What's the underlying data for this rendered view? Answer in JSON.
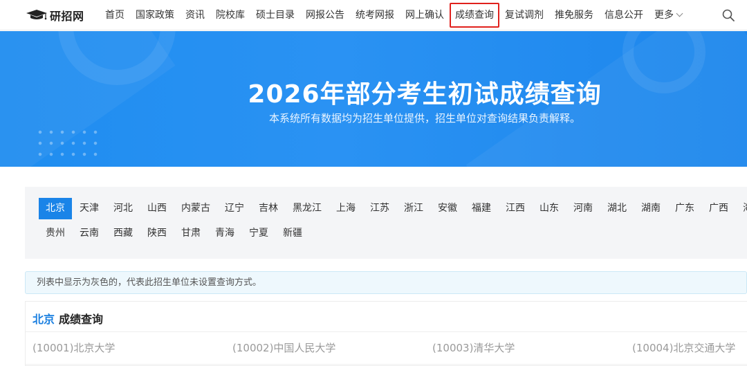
{
  "nav": {
    "logo_text": "研招网",
    "items": [
      {
        "label": "首页"
      },
      {
        "label": "国家政策"
      },
      {
        "label": "资讯"
      },
      {
        "label": "院校库"
      },
      {
        "label": "硕士目录"
      },
      {
        "label": "网报公告"
      },
      {
        "label": "统考网报"
      },
      {
        "label": "网上确认"
      },
      {
        "label": "成绩查询",
        "active": true
      },
      {
        "label": "复试调剂"
      },
      {
        "label": "推免服务"
      },
      {
        "label": "信息公开"
      }
    ],
    "more_label": "更多",
    "search_icon": "search-icon",
    "active_highlight_color": "#e0201c"
  },
  "banner": {
    "title": "2026年部分考生初试成绩查询",
    "subtitle": "本系统所有数据均为招生单位提供，招生单位对查询结果负责解释。",
    "background_color": "#2a92f3"
  },
  "provinces": {
    "row1": [
      "北京",
      "天津",
      "河北",
      "山西",
      "内蒙古",
      "辽宁",
      "吉林",
      "黑龙江",
      "上海",
      "江苏",
      "浙江",
      "安徽",
      "福建",
      "江西",
      "山东",
      "河南",
      "湖北",
      "湖南",
      "广东",
      "广西",
      "海南"
    ],
    "row2": [
      "贵州",
      "云南",
      "西藏",
      "陕西",
      "甘肃",
      "青海",
      "宁夏",
      "新疆"
    ],
    "selected": "北京",
    "selected_color": "#1a84e8"
  },
  "notice": {
    "text": "列表中显示为灰色的，代表此招生单位未设置查询方式。"
  },
  "result": {
    "region": "北京",
    "title": "成绩查询",
    "universities": [
      "(10001)北京大学",
      "(10002)中国人民大学",
      "(10003)清华大学",
      "(10004)北京交通大学"
    ],
    "disabled_color": "#9a9a9a"
  }
}
